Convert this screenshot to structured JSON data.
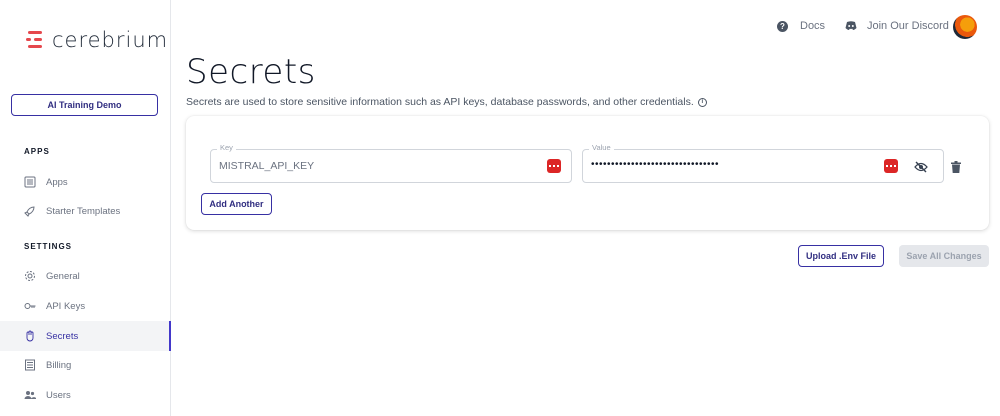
{
  "brand": {
    "name": "cerebrium",
    "accent": "#e5484d"
  },
  "sidebar": {
    "project": "AI Training Demo",
    "sections": [
      {
        "label": "APPS",
        "items": [
          {
            "label": "Apps",
            "icon": "apps-list-icon"
          },
          {
            "label": "Starter Templates",
            "icon": "rocket-icon"
          }
        ]
      },
      {
        "label": "SETTINGS",
        "items": [
          {
            "label": "General",
            "icon": "gear-icon"
          },
          {
            "label": "API Keys",
            "icon": "key-icon"
          },
          {
            "label": "Secrets",
            "icon": "hand-icon",
            "active": true
          },
          {
            "label": "Billing",
            "icon": "billing-icon"
          },
          {
            "label": "Users",
            "icon": "users-icon"
          }
        ]
      }
    ]
  },
  "header": {
    "docs_label": "Docs",
    "discord_label": "Join Our Discord"
  },
  "main": {
    "title": "Secrets",
    "description": "Secrets are used to store sensitive information such as API keys, database passwords, and other credentials.",
    "secret_row": {
      "key_label": "Key",
      "key_value": "MISTRAL_API_KEY",
      "value_label": "Value",
      "value_masked": "••••••••••••••••••••••••••••••••"
    },
    "add_another_label": "Add Another",
    "upload_label": "Upload .Env File",
    "save_label": "Save All Changes"
  },
  "colors": {
    "primary": "#3730a3",
    "danger": "#dc2626"
  }
}
